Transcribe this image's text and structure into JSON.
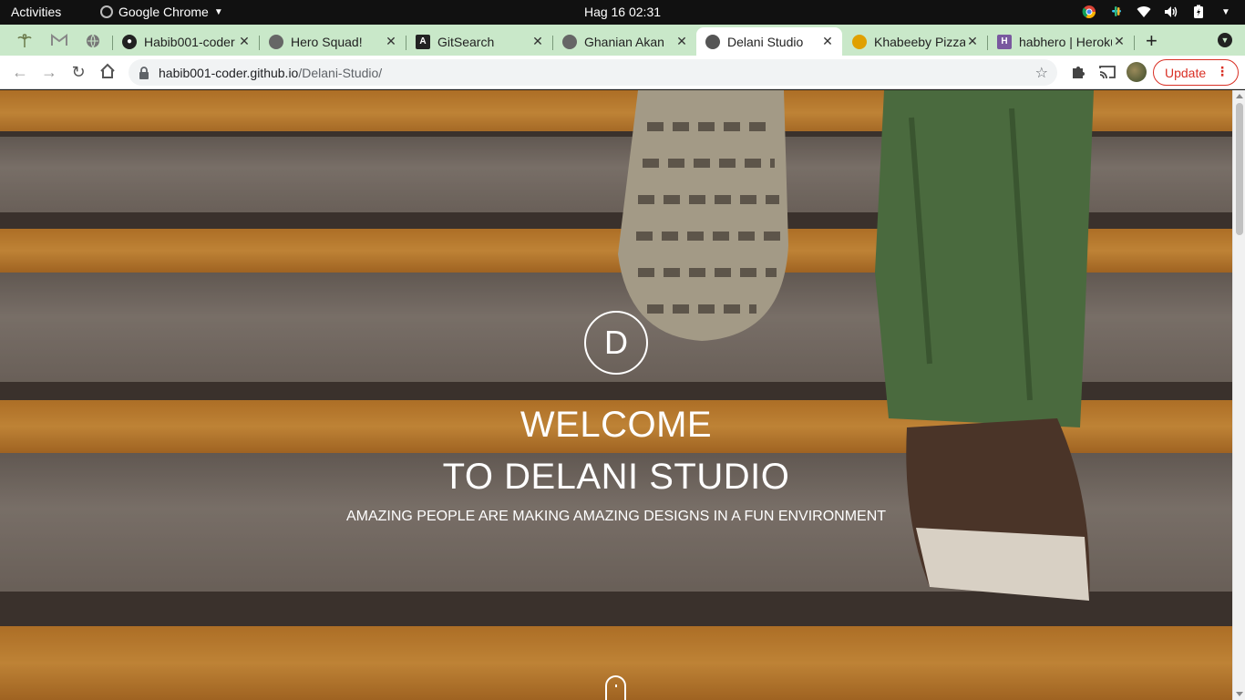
{
  "system_bar": {
    "activities": "Activities",
    "app_name": "Google Chrome",
    "clock": "Hag 16  02:31",
    "tray_icons": [
      "chrome-icon",
      "slack-icon",
      "wifi-icon",
      "volume-icon",
      "battery-icon",
      "power-menu-icon"
    ]
  },
  "tabs": [
    {
      "title": "Habib001-coder",
      "favicon": "github-icon",
      "active": false
    },
    {
      "title": "Hero Squad!",
      "favicon": "globe-icon",
      "active": false
    },
    {
      "title": "GitSearch",
      "favicon": "angular-icon",
      "active": false
    },
    {
      "title": "Ghanian Akan",
      "favicon": "globe-icon",
      "active": false
    },
    {
      "title": "Delani Studio",
      "favicon": "globe-icon",
      "active": true
    },
    {
      "title": "Khabeeby Pizza",
      "favicon": "pizza-icon",
      "active": false
    },
    {
      "title": "habhero | Heroku",
      "favicon": "heroku-icon",
      "active": false
    }
  ],
  "toolbar": {
    "url_host": "habib001-coder.github.io",
    "url_path": "/Delani-Studio/",
    "update_label": "Update"
  },
  "page": {
    "logo_letter": "D",
    "heading_line1": "WELCOME",
    "heading_line2": "TO DELANI STUDIO",
    "tagline": "AMAZING PEOPLE ARE MAKING AMAZING DESIGNS IN A FUN ENVIRONMENT"
  },
  "colors": {
    "tab_strip": "#c9e8c9",
    "update_accent": "#d93025",
    "stair_orange": "#f0a640"
  }
}
